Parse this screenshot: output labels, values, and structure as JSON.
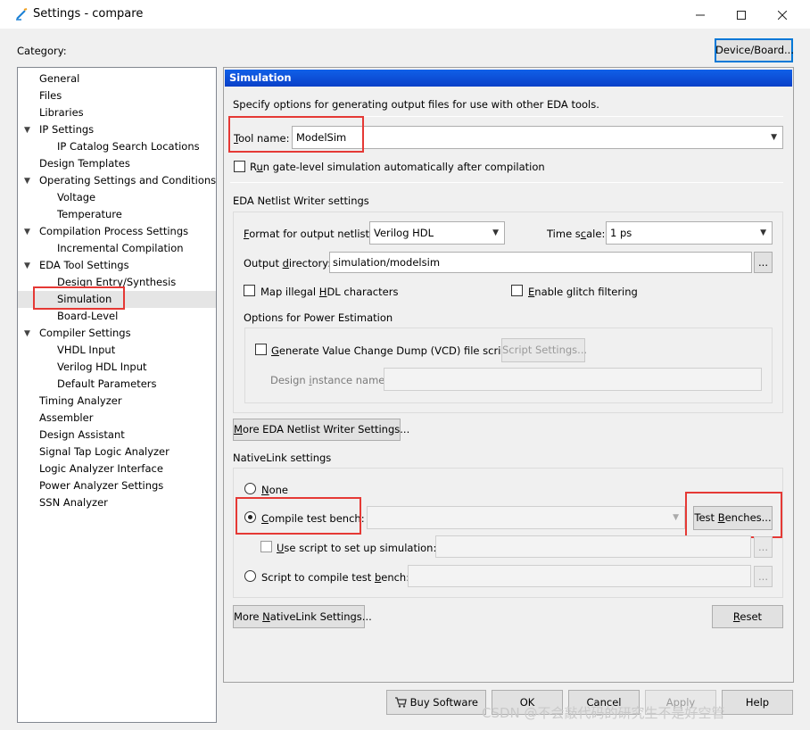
{
  "window": {
    "title": "Settings - compare"
  },
  "category_label": "Category:",
  "device_board_button": "Device/Board...",
  "tree": [
    {
      "label": "General",
      "level": 0,
      "expander": false
    },
    {
      "label": "Files",
      "level": 0,
      "expander": false
    },
    {
      "label": "Libraries",
      "level": 0,
      "expander": false
    },
    {
      "label": "IP Settings",
      "level": 0,
      "expander": true
    },
    {
      "label": "IP Catalog Search Locations",
      "level": 1,
      "expander": false
    },
    {
      "label": "Design Templates",
      "level": 0,
      "expander": false
    },
    {
      "label": "Operating Settings and Conditions",
      "level": 0,
      "expander": true
    },
    {
      "label": "Voltage",
      "level": 1,
      "expander": false
    },
    {
      "label": "Temperature",
      "level": 1,
      "expander": false
    },
    {
      "label": "Compilation Process Settings",
      "level": 0,
      "expander": true
    },
    {
      "label": "Incremental Compilation",
      "level": 1,
      "expander": false
    },
    {
      "label": "EDA Tool Settings",
      "level": 0,
      "expander": true
    },
    {
      "label": "Design Entry/Synthesis",
      "level": 1,
      "expander": false
    },
    {
      "label": "Simulation",
      "level": 1,
      "expander": false,
      "selected": true
    },
    {
      "label": "Board-Level",
      "level": 1,
      "expander": false
    },
    {
      "label": "Compiler Settings",
      "level": 0,
      "expander": true
    },
    {
      "label": "VHDL Input",
      "level": 1,
      "expander": false
    },
    {
      "label": "Verilog HDL Input",
      "level": 1,
      "expander": false
    },
    {
      "label": "Default Parameters",
      "level": 1,
      "expander": false
    },
    {
      "label": "Timing Analyzer",
      "level": 0,
      "expander": false
    },
    {
      "label": "Assembler",
      "level": 0,
      "expander": false
    },
    {
      "label": "Design Assistant",
      "level": 0,
      "expander": false
    },
    {
      "label": "Signal Tap Logic Analyzer",
      "level": 0,
      "expander": false
    },
    {
      "label": "Logic Analyzer Interface",
      "level": 0,
      "expander": false
    },
    {
      "label": "Power Analyzer Settings",
      "level": 0,
      "expander": false
    },
    {
      "label": "SSN Analyzer",
      "level": 0,
      "expander": false
    }
  ],
  "panel": {
    "header": "Simulation",
    "description": "Specify options for generating output files for use with other EDA tools.",
    "tool_name_label": "Tool name:",
    "tool_name_value": "ModelSim",
    "run_gate_level_label": "Run gate-level simulation automatically after compilation",
    "eda_netlist_title": "EDA Netlist Writer settings",
    "format_label": "Format for output netlist:",
    "format_value": "Verilog HDL",
    "timescale_label": "Time scale:",
    "timescale_value": "1 ps",
    "output_dir_label": "Output directory:",
    "output_dir_value": "simulation/modelsim",
    "browse": "...",
    "map_illegal_label": "Map illegal HDL characters",
    "glitch_label": "Enable glitch filtering",
    "power_title": "Options for Power Estimation",
    "vcd_label": "Generate Value Change Dump (VCD) file script",
    "script_settings": "Script Settings...",
    "design_instance_label": "Design instance name:",
    "design_instance_value": "",
    "more_eda_button": "More EDA Netlist Writer Settings...",
    "nativelink_title": "NativeLink settings",
    "none_label": "None",
    "compile_tb_label": "Compile test bench:",
    "compile_tb_value": "",
    "test_benches_button": "Test Benches...",
    "use_script_label": "Use script to set up simulation:",
    "use_script_value": "",
    "script_compile_label": "Script to compile test bench:",
    "script_compile_value": "",
    "more_nativelink_button": "More NativeLink Settings...",
    "reset_button": "Reset"
  },
  "footer": {
    "buy_software": "Buy Software",
    "ok": "OK",
    "cancel": "Cancel",
    "apply": "Apply",
    "help": "Help"
  },
  "watermark": "CSDN @不会敲代码的研究生不是好空管"
}
